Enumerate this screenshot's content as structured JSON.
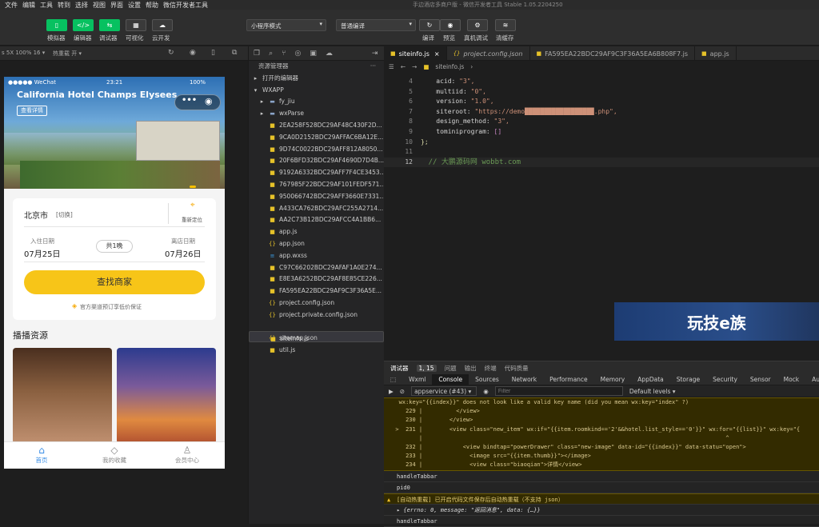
{
  "menu": {
    "items": [
      "文件",
      "编辑",
      "工具",
      "转到",
      "选择",
      "视图",
      "界面",
      "设置",
      "帮助",
      "微信开发者工具"
    ],
    "window_title": "手边酒店多商户版 - 微信开发者工具 Stable 1.05.2204250"
  },
  "toolbar": {
    "buttons": [
      "模拟器",
      "编辑器",
      "调试器",
      "可视化",
      "云开发"
    ],
    "mode_select": "小程序模式",
    "compile_select": "普通编译",
    "actions": [
      "编译",
      "预览",
      "真机调试",
      "清缓存"
    ]
  },
  "sim_header": {
    "device": "s 5X 100% 16 ▾",
    "hot_reload": "热重载 开 ▾"
  },
  "phone": {
    "carrier": "●●●●● WeChat",
    "time": "23:21",
    "battery": "100%",
    "hotel_name": "California Hotel Champs Elysees",
    "detail_button": "查看详情",
    "city": "北京市",
    "switch": "[切换]",
    "relocate": "重新定位",
    "checkin_label": "入住日期",
    "checkin_date": "07月25日",
    "nights": "共1晚",
    "checkout_label": "离店日期",
    "checkout_date": "07月26日",
    "search_button": "查找商家",
    "guarantee": "官方渠道预订享低价保证",
    "section_title": "播播资源",
    "tabs": [
      "首页",
      "我的收藏",
      "会员中心"
    ]
  },
  "explorer": {
    "title": "资源管理器",
    "open_editors": "打开的编辑器",
    "root": "WXAPP",
    "folders": [
      "fy_jiu",
      "wxParse"
    ],
    "files": [
      "2EA258F528DC29AF48C430F2D...",
      "9CA0D2152BDC29AFFAC6BA12E...",
      "9D74C0022BDC29AFF812A8050...",
      "20F6BFD32BDC29AF4690D7D4B...",
      "9192A6332BDC29AFF7F4CE3453...",
      "767985F22BDC29AF101FEDF571...",
      "950066742BDC29AFF3660E7331...",
      "A433CA762BDC29AFC255A2714...",
      "AA2C73B12BDC29AFCC4A1BB6..."
    ],
    "files2": [
      "app.js",
      "app.json",
      "app.wxss"
    ],
    "files3": [
      "C97C66202BDC29AFAF1A0E274...",
      "E8E3A6252BDC29AF8E85CE226...",
      "FA595EA22BDC29AF9C3F36A5E..."
    ],
    "files4": [
      "project.config.json",
      "project.private.config.json",
      "siteinfo.js",
      "sitemap.json",
      "util.js"
    ]
  },
  "editor": {
    "tabs": [
      "siteinfo.js",
      "project.config.json",
      "FA595EA22BDC29AF9C3F36A5EA6B808F7.js",
      "app.js"
    ],
    "breadcrumb": "siteinfo.js",
    "code": [
      {
        "ln": "4",
        "key": "acid",
        "val": "\"3\","
      },
      {
        "ln": "5",
        "key": "multiid",
        "val": "\"0\","
      },
      {
        "ln": "6",
        "key": "version",
        "val": "\"1.0\","
      },
      {
        "ln": "7",
        "key": "siteroot",
        "val": "\"https://demo██████████████████.php\","
      },
      {
        "ln": "8",
        "key": "design_method",
        "val": "\"3\","
      },
      {
        "ln": "9",
        "key": "tominiprogram",
        "val": "[]"
      }
    ],
    "close_brace": "};",
    "comment": "// 大鹏源码网 wobbt.com",
    "watermark": "玩技e族"
  },
  "devtools": {
    "header": [
      "调试器",
      "1, 15",
      "问题",
      "输出",
      "终端",
      "代码质量"
    ],
    "tabs": [
      "Wxml",
      "Console",
      "Sources",
      "Network",
      "Performance",
      "Memory",
      "AppData",
      "Storage",
      "Security",
      "Sensor",
      "Mock",
      "Audits"
    ],
    "context": "appservice (#43)",
    "filter_placeholder": "Filter",
    "levels": "Default levels ▾",
    "warn_lines": [
      "   wx:key=\"{{index}}\" does not look like a valid key name (did you mean wx:key=\"index\" ?)",
      "     229 |          </view>",
      "     230 |        </view>",
      "  >  231 |        <view class=\"new_item\" wx:if=\"{{item.roomkind=='2'&&hotel.list_style=='0'}}\" wx:for=\"{{list}}\" wx:key=\"{",
      "         |                                                                                          ^",
      "     232 |            <view bindtap=\"powerDrawer\" class=\"new-image\" data-id=\"{{index}}\" data-statu=\"open\">",
      "     233 |              <image src=\"{{item.thumb}}\"></image>",
      "     234 |              <view class=\"biaoqian\">详情</view>"
    ],
    "logs": [
      "handleTabbar",
      "pid0",
      "[自动热重载] 已开启代码文件保存后自动热重载（不支持 json）",
      "▸ {errno: 0, message: \"返回消息\", data: {…}}",
      "handleTabbar"
    ]
  }
}
